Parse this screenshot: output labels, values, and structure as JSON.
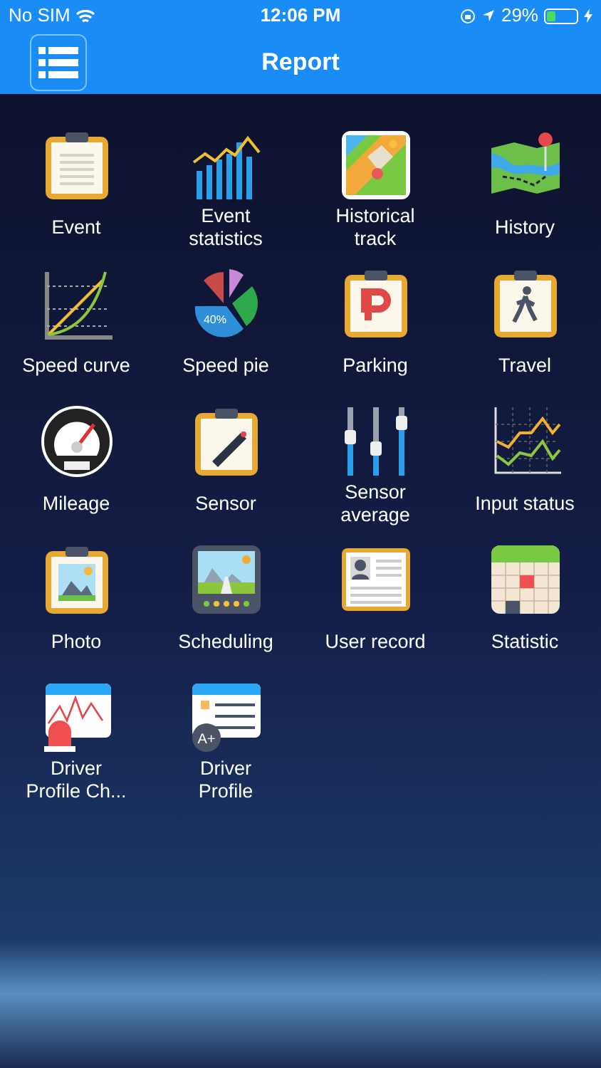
{
  "status_bar": {
    "carrier": "No SIM",
    "time": "12:06 PM",
    "battery_text": "29%",
    "battery": {
      "level": 0.29
    }
  },
  "nav_bar": {
    "title": "Report"
  },
  "reports": [
    {
      "kind": "clipboard-lines",
      "label": "Event"
    },
    {
      "kind": "bar-chart",
      "label": "Event statistics"
    },
    {
      "kind": "route-map",
      "label": "Historical track"
    },
    {
      "kind": "map-pin",
      "label": "History"
    },
    {
      "kind": "curve",
      "label": "Speed curve"
    },
    {
      "kind": "pie",
      "label": "Speed pie",
      "icon_text": "40%"
    },
    {
      "kind": "clipboard-p",
      "label": "Parking"
    },
    {
      "kind": "clipboard-walker",
      "label": "Travel"
    },
    {
      "kind": "gauge",
      "label": "Mileage"
    },
    {
      "kind": "clipboard-sensor",
      "label": "Sensor"
    },
    {
      "kind": "sliders",
      "label": "Sensor average"
    },
    {
      "kind": "line-chart",
      "label": "Input status"
    },
    {
      "kind": "clipboard-photo",
      "label": "Photo"
    },
    {
      "kind": "road-screen",
      "label": "Scheduling"
    },
    {
      "kind": "id-card",
      "label": "User record"
    },
    {
      "kind": "calendar-grid",
      "label": "Statistic"
    },
    {
      "kind": "alarm-chart",
      "label": "Driver Profile Ch..."
    },
    {
      "kind": "profile-list",
      "label": "Driver Profile",
      "icon_text": "A+"
    }
  ]
}
